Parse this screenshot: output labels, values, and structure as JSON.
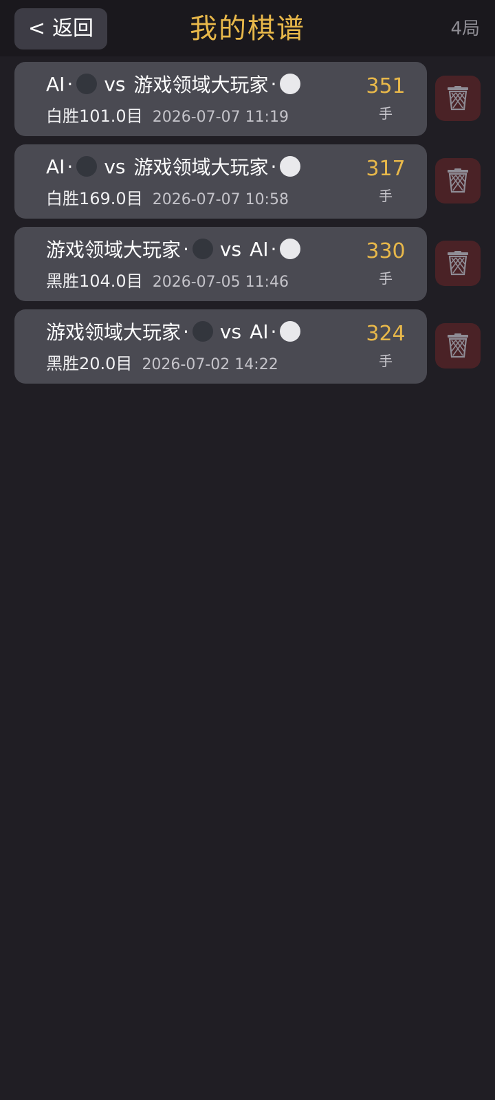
{
  "header": {
    "back_arrow": "<",
    "back_label": "返回",
    "title": "我的棋谱",
    "count": "4局"
  },
  "colors": {
    "accent": "#e8b84a",
    "card": "#4a4a52",
    "delete_bg": "#4a2226",
    "background": "#201e24"
  },
  "games": [
    {
      "black_player": "AI",
      "white_player": "游戏领域大玩家",
      "vs": "vs",
      "result": "白胜101.0目",
      "date": "2026-07-07 11:19",
      "moves": "351",
      "moves_unit": "手"
    },
    {
      "black_player": "AI",
      "white_player": "游戏领域大玩家",
      "vs": "vs",
      "result": "白胜169.0目",
      "date": "2026-07-07 10:58",
      "moves": "317",
      "moves_unit": "手"
    },
    {
      "black_player": "游戏领域大玩家",
      "white_player": "AI",
      "vs": "vs",
      "result": "黑胜104.0目",
      "date": "2026-07-05 11:46",
      "moves": "330",
      "moves_unit": "手"
    },
    {
      "black_player": "游戏领域大玩家",
      "white_player": "AI",
      "vs": "vs",
      "result": "黑胜20.0目",
      "date": "2026-07-02 14:22",
      "moves": "324",
      "moves_unit": "手"
    }
  ],
  "icons": {
    "stone_separator": "·",
    "black_stone": "black-stone-icon",
    "white_stone": "white-stone-icon",
    "delete": "trash-icon"
  }
}
